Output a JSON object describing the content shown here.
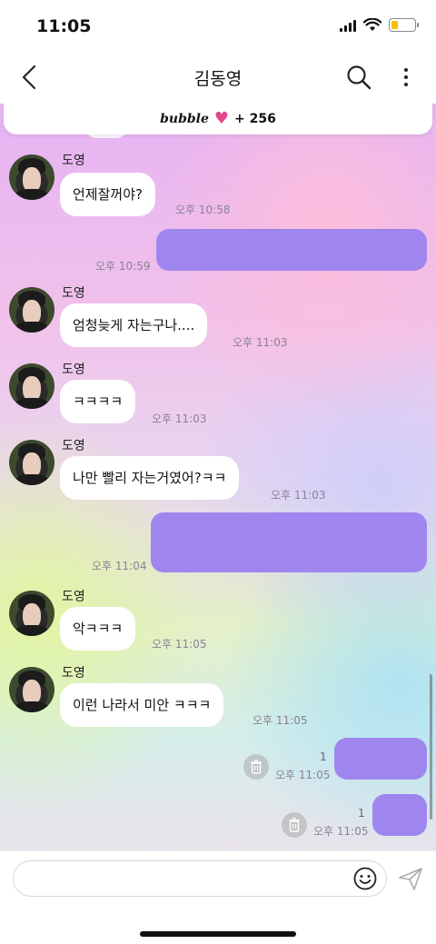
{
  "status_bar": {
    "time": "11:05"
  },
  "header": {
    "title": "김동영"
  },
  "banner": {
    "brand": "bubble",
    "count": "+ 256"
  },
  "messages": [
    {
      "type": "in",
      "sender": "도영",
      "text": "언제잘꺼야?",
      "time": "오후 10:58"
    },
    {
      "type": "out",
      "time": "오후 10:59"
    },
    {
      "type": "in",
      "sender": "도영",
      "text": "엄청늦게 자는구나....",
      "time": "오후 11:03"
    },
    {
      "type": "in",
      "sender": "도영",
      "text": "ㅋㅋㅋㅋ",
      "time": "오후 11:03"
    },
    {
      "type": "in",
      "sender": "도영",
      "text": "나만 빨리 자는거였어?ㅋㅋ",
      "time": "오후 11:03"
    },
    {
      "type": "out",
      "time": "오후 11:04"
    },
    {
      "type": "in",
      "sender": "도영",
      "text": "악ㅋㅋㅋ",
      "time": "오후 11:05"
    },
    {
      "type": "in",
      "sender": "도영",
      "text": "이런 나라서 미안 ㅋㅋㅋ",
      "time": "오후 11:05"
    },
    {
      "type": "out",
      "time": "오후 11:05",
      "unread": "1"
    },
    {
      "type": "out",
      "time": "오후 11:05",
      "unread": "1"
    }
  ],
  "input": {
    "placeholder": ""
  },
  "colors": {
    "outgoing_bubble": "#9f86ee",
    "heart": "#e7468e",
    "battery": "#f5c400"
  }
}
